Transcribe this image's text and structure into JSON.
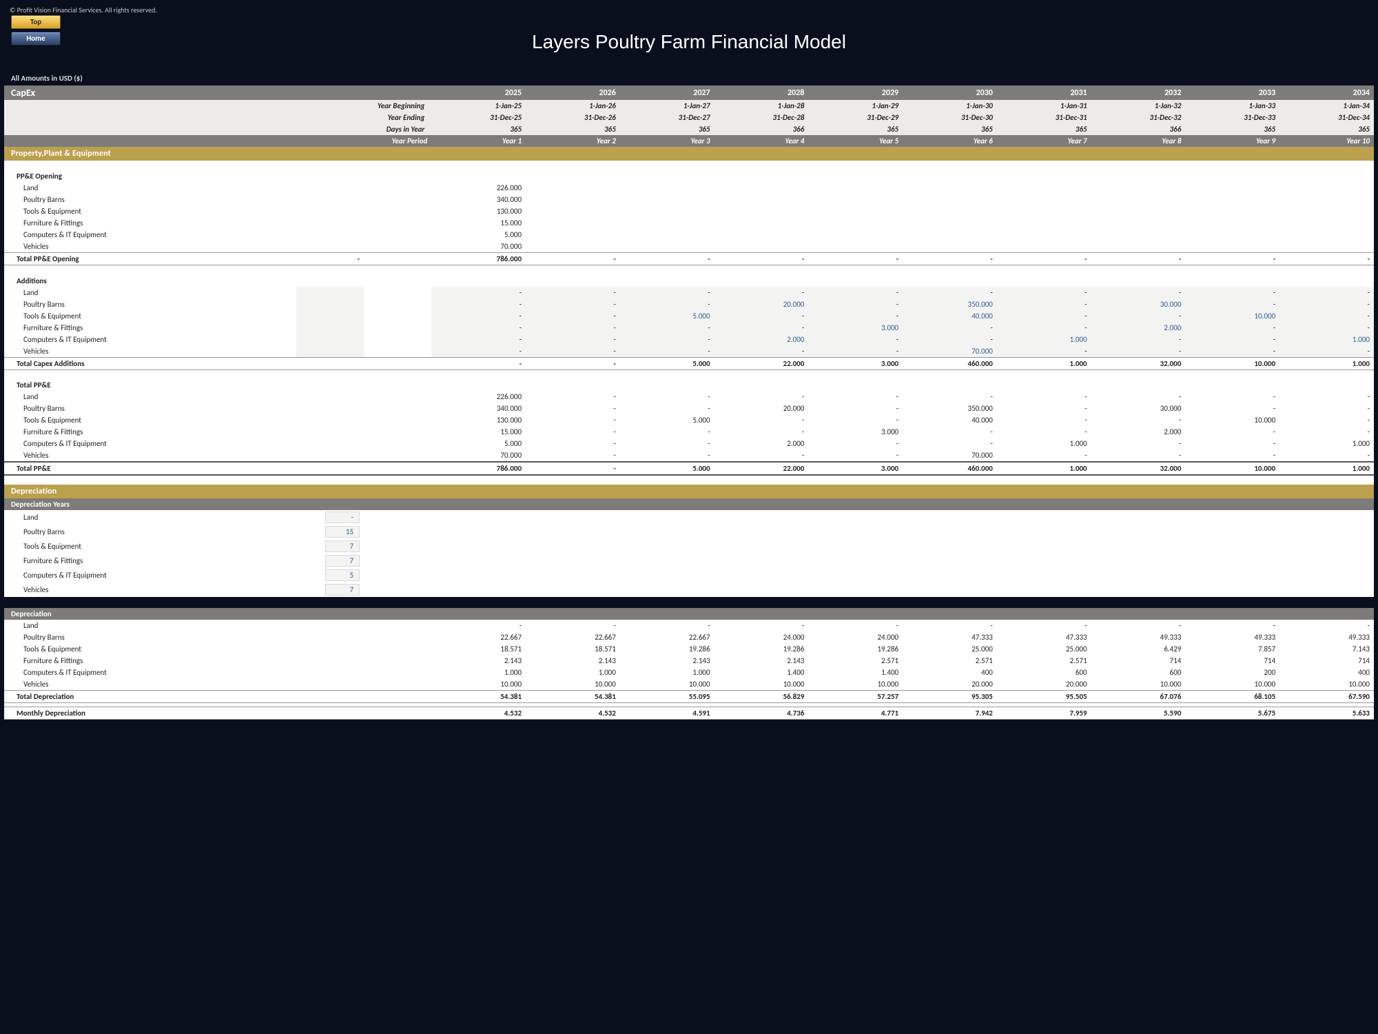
{
  "copyright": "© Profit Vision Financial Services. All rights reserved.",
  "nav": {
    "top": "Top",
    "home": "Home"
  },
  "title": "Layers Poultry Farm Financial Model",
  "amounts_note": "All Amounts in  USD ($)",
  "section_titles": {
    "capex": "CapEx",
    "ppe": "Property,Plant & Equipment",
    "depreciation": "Depreciation",
    "dep_years": "Depreciation Years",
    "dep_detail": "Depreciation"
  },
  "years": [
    "2025",
    "2026",
    "2027",
    "2028",
    "2029",
    "2030",
    "2031",
    "2032",
    "2033",
    "2034"
  ],
  "meta": {
    "labels": {
      "yb": "Year Beginning",
      "ye": "Year Ending",
      "diy": "Days in Year",
      "yp": "Year Period"
    },
    "year_begin": [
      "1-Jan-25",
      "1-Jan-26",
      "1-Jan-27",
      "1-Jan-28",
      "1-Jan-29",
      "1-Jan-30",
      "1-Jan-31",
      "1-Jan-32",
      "1-Jan-33",
      "1-Jan-34"
    ],
    "year_end": [
      "31-Dec-25",
      "31-Dec-26",
      "31-Dec-27",
      "31-Dec-28",
      "31-Dec-29",
      "31-Dec-30",
      "31-Dec-31",
      "31-Dec-32",
      "31-Dec-33",
      "31-Dec-34"
    ],
    "days": [
      "365",
      "365",
      "365",
      "366",
      "365",
      "365",
      "365",
      "366",
      "365",
      "365"
    ],
    "period": [
      "Year 1",
      "Year 2",
      "Year 3",
      "Year 4",
      "Year 5",
      "Year 6",
      "Year 7",
      "Year 8",
      "Year 9",
      "Year 10"
    ]
  },
  "categories": [
    "Land",
    "Poultry Barns",
    "Tools & Equipment",
    "Furniture & Fittings",
    "Computers & IT Equipment",
    "Vehicles"
  ],
  "ppe_opening": {
    "heading": "PP&E Opening",
    "rows": [
      {
        "label": "Land",
        "vals": [
          "226.000",
          "",
          "",
          "",
          "",
          "",
          "",
          "",
          "",
          ""
        ]
      },
      {
        "label": "Poultry Barns",
        "vals": [
          "340.000",
          "",
          "",
          "",
          "",
          "",
          "",
          "",
          "",
          ""
        ]
      },
      {
        "label": "Tools & Equipment",
        "vals": [
          "130.000",
          "",
          "",
          "",
          "",
          "",
          "",
          "",
          "",
          ""
        ]
      },
      {
        "label": "Furniture & Fittings",
        "vals": [
          "15.000",
          "",
          "",
          "",
          "",
          "",
          "",
          "",
          "",
          ""
        ]
      },
      {
        "label": "Computers & IT Equipment",
        "vals": [
          "5.000",
          "",
          "",
          "",
          "",
          "",
          "",
          "",
          "",
          ""
        ]
      },
      {
        "label": "Vehicles",
        "vals": [
          "70.000",
          "",
          "",
          "",
          "",
          "",
          "",
          "",
          "",
          ""
        ]
      }
    ],
    "total_label": "Total PP&E Opening",
    "total_pre": "-",
    "total": [
      "786.000",
      "-",
      "-",
      "-",
      "-",
      "-",
      "-",
      "-",
      "-",
      "-"
    ]
  },
  "additions": {
    "heading": "Additions",
    "rows": [
      {
        "label": "Land",
        "vals": [
          "-",
          "-",
          "-",
          "-",
          "-",
          "-",
          "-",
          "-",
          "-",
          "-"
        ]
      },
      {
        "label": "Poultry Barns",
        "vals": [
          "-",
          "-",
          "-",
          "20.000",
          "-",
          "350.000",
          "-",
          "30.000",
          "-",
          "-"
        ]
      },
      {
        "label": "Tools & Equipment",
        "vals": [
          "-",
          "-",
          "5.000",
          "-",
          "-",
          "40.000",
          "-",
          "-",
          "10.000",
          "-"
        ]
      },
      {
        "label": "Furniture & Fittings",
        "vals": [
          "-",
          "-",
          "-",
          "-",
          "3.000",
          "-",
          "-",
          "2.000",
          "-",
          "-"
        ]
      },
      {
        "label": "Computers & IT Equipment",
        "vals": [
          "-",
          "-",
          "-",
          "2.000",
          "-",
          "-",
          "1.000",
          "-",
          "-",
          "1.000"
        ]
      },
      {
        "label": "Vehicles",
        "vals": [
          "-",
          "-",
          "-",
          "-",
          "-",
          "70.000",
          "-",
          "-",
          "-",
          "-"
        ]
      }
    ],
    "total_label": "Total Capex Additions",
    "total": [
      "-",
      "-",
      "5.000",
      "22.000",
      "3.000",
      "460.000",
      "1.000",
      "32.000",
      "10.000",
      "1.000"
    ]
  },
  "total_ppe": {
    "heading": "Total PP&E",
    "rows": [
      {
        "label": "Land",
        "vals": [
          "226.000",
          "-",
          "-",
          "-",
          "-",
          "-",
          "-",
          "-",
          "-",
          "-"
        ]
      },
      {
        "label": "Poultry Barns",
        "vals": [
          "340.000",
          "-",
          "-",
          "20.000",
          "-",
          "350.000",
          "-",
          "30.000",
          "-",
          "-"
        ]
      },
      {
        "label": "Tools & Equipment",
        "vals": [
          "130.000",
          "-",
          "5.000",
          "-",
          "-",
          "40.000",
          "-",
          "-",
          "10.000",
          "-"
        ]
      },
      {
        "label": "Furniture & Fittings",
        "vals": [
          "15.000",
          "-",
          "-",
          "-",
          "3.000",
          "-",
          "-",
          "2.000",
          "-",
          "-"
        ]
      },
      {
        "label": "Computers & IT Equipment",
        "vals": [
          "5.000",
          "-",
          "-",
          "2.000",
          "-",
          "-",
          "1.000",
          "-",
          "-",
          "1.000"
        ]
      },
      {
        "label": "Vehicles",
        "vals": [
          "70.000",
          "-",
          "-",
          "-",
          "-",
          "70.000",
          "-",
          "-",
          "-",
          "-"
        ]
      }
    ],
    "total_label": "Total PP&E",
    "total": [
      "786.000",
      "-",
      "5.000",
      "22.000",
      "3.000",
      "460.000",
      "1.000",
      "32.000",
      "10.000",
      "1.000"
    ]
  },
  "dep_years": [
    {
      "label": "Land",
      "val": "-"
    },
    {
      "label": "Poultry Barns",
      "val": "15"
    },
    {
      "label": "Tools & Equipment",
      "val": "7"
    },
    {
      "label": "Furniture & Fittings",
      "val": "7"
    },
    {
      "label": "Computers & IT Equipment",
      "val": "5"
    },
    {
      "label": "Vehicles",
      "val": "7"
    }
  ],
  "dep_detail": {
    "rows": [
      {
        "label": "Land",
        "vals": [
          "-",
          "-",
          "-",
          "-",
          "-",
          "-",
          "-",
          "-",
          "-",
          "-"
        ]
      },
      {
        "label": "Poultry Barns",
        "vals": [
          "22.667",
          "22.667",
          "22.667",
          "24.000",
          "24.000",
          "47.333",
          "47.333",
          "49.333",
          "49.333",
          "49.333"
        ]
      },
      {
        "label": "Tools & Equipment",
        "vals": [
          "18.571",
          "18.571",
          "19.286",
          "19.286",
          "19.286",
          "25.000",
          "25.000",
          "6.429",
          "7.857",
          "7.143"
        ]
      },
      {
        "label": "Furniture & Fittings",
        "vals": [
          "2.143",
          "2.143",
          "2.143",
          "2.143",
          "2.571",
          "2.571",
          "2.571",
          "714",
          "714",
          "714"
        ]
      },
      {
        "label": "Computers & IT Equipment",
        "vals": [
          "1.000",
          "1.000",
          "1.000",
          "1.400",
          "1.400",
          "400",
          "600",
          "600",
          "200",
          "400"
        ]
      },
      {
        "label": "Vehicles",
        "vals": [
          "10.000",
          "10.000",
          "10.000",
          "10.000",
          "10.000",
          "20.000",
          "20.000",
          "10.000",
          "10.000",
          "10.000"
        ]
      }
    ],
    "total_label": "Total Depreciation",
    "total": [
      "54.381",
      "54.381",
      "55.095",
      "56.829",
      "57.257",
      "95.305",
      "95.505",
      "67.076",
      "68.105",
      "67.590"
    ],
    "monthly_label": "Monthly Depreciation",
    "monthly": [
      "4.532",
      "4.532",
      "4.591",
      "4.736",
      "4.771",
      "7.942",
      "7.959",
      "5.590",
      "5.675",
      "5.633"
    ]
  },
  "chart_data": {
    "type": "table",
    "title": "Layers Poultry Farm Financial Model — CapEx",
    "years": [
      2025,
      2026,
      2027,
      2028,
      2029,
      2030,
      2031,
      2032,
      2033,
      2034
    ],
    "ppe_opening": {
      "Land": 226000,
      "Poultry Barns": 340000,
      "Tools & Equipment": 130000,
      "Furniture & Fittings": 15000,
      "Computers & IT Equipment": 5000,
      "Vehicles": 70000,
      "Total": 786000
    },
    "capex_additions": {
      "Land": [
        0,
        0,
        0,
        0,
        0,
        0,
        0,
        0,
        0,
        0
      ],
      "Poultry Barns": [
        0,
        0,
        0,
        20000,
        0,
        350000,
        0,
        30000,
        0,
        0
      ],
      "Tools & Equipment": [
        0,
        0,
        5000,
        0,
        0,
        40000,
        0,
        0,
        10000,
        0
      ],
      "Furniture & Fittings": [
        0,
        0,
        0,
        0,
        3000,
        0,
        0,
        2000,
        0,
        0
      ],
      "Computers & IT Equipment": [
        0,
        0,
        0,
        2000,
        0,
        0,
        1000,
        0,
        0,
        1000
      ],
      "Vehicles": [
        0,
        0,
        0,
        0,
        0,
        70000,
        0,
        0,
        0,
        0
      ],
      "Total": [
        0,
        0,
        5000,
        22000,
        3000,
        460000,
        1000,
        32000,
        10000,
        1000
      ]
    },
    "depreciation_years": {
      "Land": null,
      "Poultry Barns": 15,
      "Tools & Equipment": 7,
      "Furniture & Fittings": 7,
      "Computers & IT Equipment": 5,
      "Vehicles": 7
    },
    "depreciation": {
      "Land": [
        0,
        0,
        0,
        0,
        0,
        0,
        0,
        0,
        0,
        0
      ],
      "Poultry Barns": [
        22667,
        22667,
        22667,
        24000,
        24000,
        47333,
        47333,
        49333,
        49333,
        49333
      ],
      "Tools & Equipment": [
        18571,
        18571,
        19286,
        19286,
        19286,
        25000,
        25000,
        6429,
        7857,
        7143
      ],
      "Furniture & Fittings": [
        2143,
        2143,
        2143,
        2143,
        2571,
        2571,
        2571,
        714,
        714,
        714
      ],
      "Computers & IT Equipment": [
        1000,
        1000,
        1000,
        1400,
        1400,
        400,
        600,
        600,
        200,
        400
      ],
      "Vehicles": [
        10000,
        10000,
        10000,
        10000,
        10000,
        20000,
        20000,
        10000,
        10000,
        10000
      ],
      "Total": [
        54381,
        54381,
        55095,
        56829,
        57257,
        95305,
        95505,
        67076,
        68105,
        67590
      ],
      "Monthly": [
        4532,
        4532,
        4591,
        4736,
        4771,
        7942,
        7959,
        5590,
        5675,
        5633
      ]
    }
  }
}
